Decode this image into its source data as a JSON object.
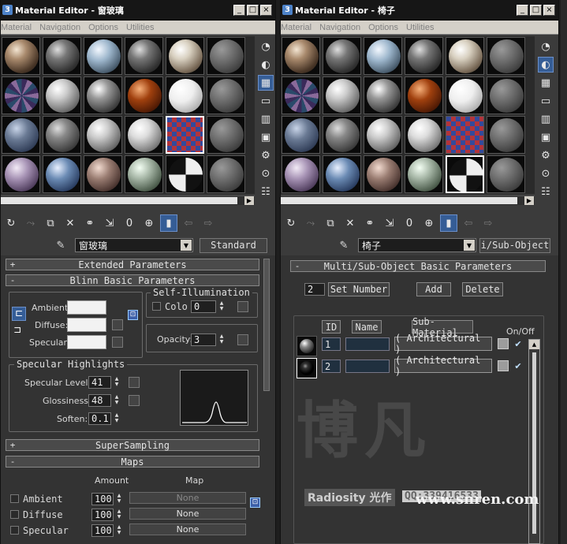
{
  "left": {
    "title": "Material Editor - 窗玻璃",
    "menu": [
      "Material",
      "Navigation",
      "Options",
      "Utilities"
    ],
    "name_value": "窗玻璃",
    "type_label": "Standard",
    "rollouts": {
      "extended": {
        "pm": "+",
        "label": "Extended Parameters"
      },
      "blinn": {
        "pm": "-",
        "label": "Blinn Basic Parameters"
      },
      "supersampling": {
        "pm": "+",
        "label": "SuperSampling"
      },
      "maps": {
        "pm": "-",
        "label": "Maps"
      }
    },
    "ambient_label": "Ambient:",
    "diffuse_label": "Diffuse:",
    "specular_label": "Specular:",
    "self_illum_title": "Self-Illumination",
    "color_label": "Colo",
    "self_illum_value": "0",
    "opacity_label": "Opacity:",
    "opacity_value": "3",
    "highlights_title": "Specular Highlights",
    "specular_level_label": "Specular Level:",
    "specular_level_value": "41",
    "glossiness_label": "Glossiness:",
    "glossiness_value": "48",
    "soften_label": "Soften:",
    "soften_value": "0.1",
    "maps_amount_header": "Amount",
    "maps_map_header": "Map",
    "maps": [
      {
        "name": "Ambient",
        "amount": "100",
        "map": "None"
      },
      {
        "name": "Diffuse",
        "amount": "100",
        "map": "None"
      },
      {
        "name": "Specular",
        "amount": "100",
        "map": "None"
      }
    ]
  },
  "right": {
    "title": "Material Editor - 椅子",
    "menu": [
      "Material",
      "Navigation",
      "Options",
      "Utilities"
    ],
    "name_value": "椅子",
    "type_label": "i/Sub-Object",
    "rollout": {
      "pm": "-",
      "label": "Multi/Sub-Object Basic Parameters"
    },
    "count_value": "2",
    "set_number_label": "Set Number",
    "add_label": "Add",
    "delete_label": "Delete",
    "col_id": "ID",
    "col_name": "Name",
    "col_sub": "Sub-Material",
    "col_onoff": "On/Off",
    "rows": [
      {
        "id": "1",
        "name": "",
        "material": "( Architectural )"
      },
      {
        "id": "2",
        "name": "",
        "material": "( Architectural )"
      }
    ],
    "watermark_main": "博凡",
    "watermark_sub": "Radiosity 光作",
    "watermark_phone": "QQ:339416533",
    "watermark_url": "www.snren.com"
  },
  "window_buttons": [
    "_",
    "□",
    "×"
  ],
  "toolbar_icon_names": [
    "get-material-icon",
    "put-to-scene-icon",
    "assign-material-icon",
    "reset-icon",
    "make-unique-icon",
    "put-to-library-icon",
    "material-effects-icon",
    "show-map-icon",
    "show-end-result-icon",
    "go-to-parent-icon",
    "go-forward-icon"
  ],
  "sidebar_icon_names": [
    "sample-type-icon",
    "backlight-icon",
    "background-icon",
    "sample-uv-tiling-icon",
    "video-color-check-icon",
    "make-preview-icon",
    "options-icon",
    "select-by-material-icon",
    "material-navigator-icon"
  ]
}
